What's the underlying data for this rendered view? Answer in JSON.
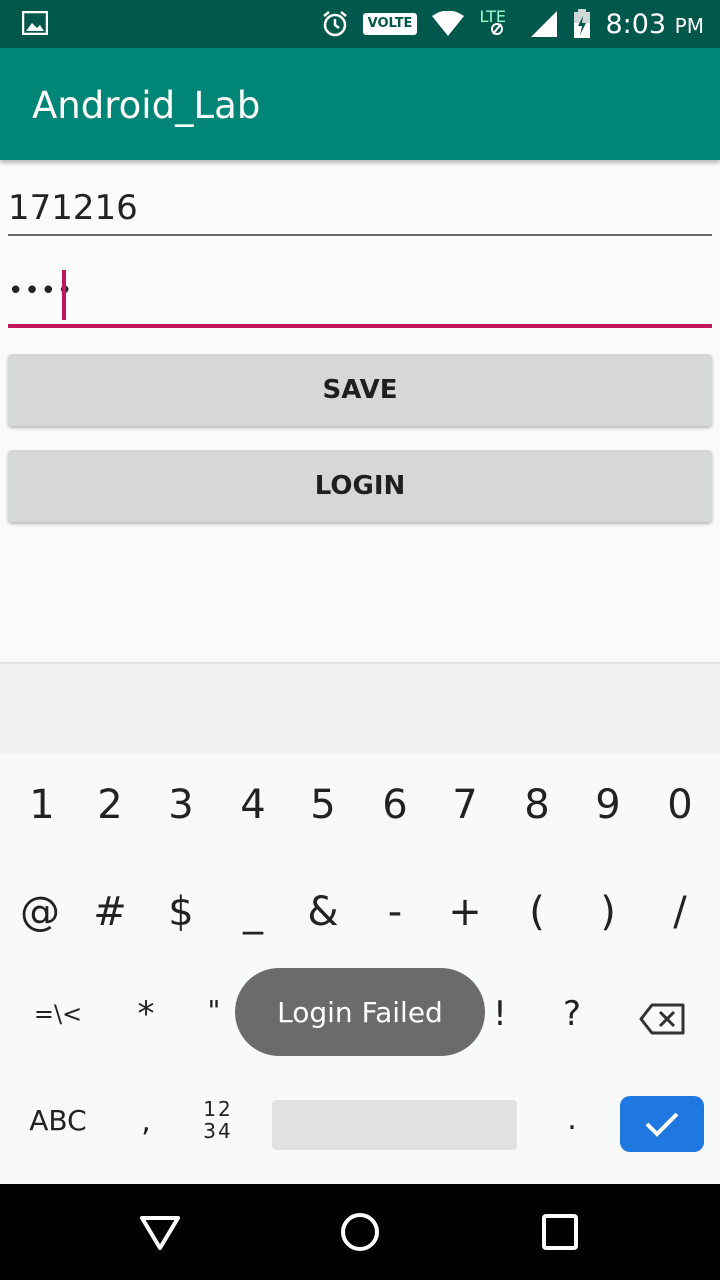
{
  "status_bar": {
    "volte": "VOLTE",
    "lte": "LTE",
    "time": "8:03",
    "ampm": "PM",
    "icons": [
      "gallery-icon",
      "alarm-icon",
      "wifi-icon",
      "signal-icon",
      "battery-icon"
    ]
  },
  "app_bar": {
    "title": "Android_Lab"
  },
  "form": {
    "username_value": "171216",
    "password_value": "••••",
    "save_label": "SAVE",
    "login_label": "LOGIN"
  },
  "keyboard": {
    "row1": [
      "1",
      "2",
      "3",
      "4",
      "5",
      "6",
      "7",
      "8",
      "9",
      "0"
    ],
    "row2": [
      "@",
      "#",
      "$",
      "_",
      "&",
      "-",
      "+",
      "(",
      ")",
      "/"
    ],
    "row3": [
      "=\\<",
      "*",
      "\"",
      "'",
      ":",
      ";",
      "!",
      "?"
    ],
    "abc_label": "ABC",
    "comma": ",",
    "numkey_top": "12",
    "numkey_bottom": "34",
    "period": "."
  },
  "toast": {
    "message": "Login Failed"
  },
  "colors": {
    "primary": "#008577",
    "primary_dark": "#00574b",
    "accent": "#c2185b",
    "enter": "#1e78e0"
  }
}
